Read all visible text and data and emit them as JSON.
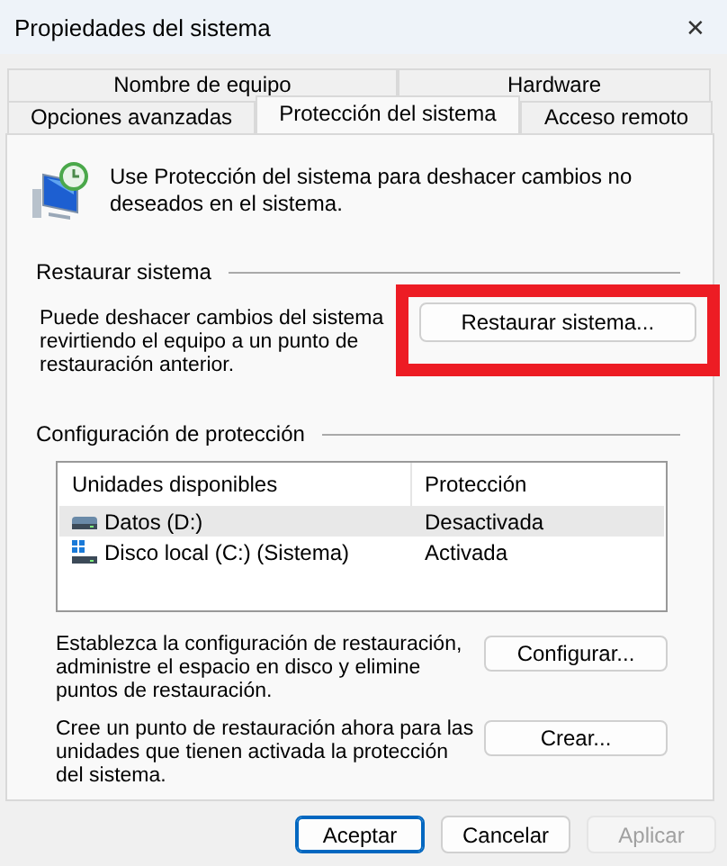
{
  "window": {
    "title": "Propiedades del sistema",
    "close": "✕"
  },
  "tabs": [
    [
      {
        "label": "Nombre de equipo",
        "selected": false
      },
      {
        "label": "Hardware",
        "selected": false
      }
    ],
    [
      {
        "label": "Opciones avanzadas",
        "selected": false
      },
      {
        "label": "Protección del sistema",
        "selected": true
      },
      {
        "label": "Acceso remoto",
        "selected": false
      }
    ]
  ],
  "intro": "Use Protección del sistema para deshacer cambios no deseados en el sistema.",
  "restore_group": {
    "title": "Restaurar sistema",
    "text": "Puede deshacer cambios del sistema revirtiendo el equipo a un punto de restauración anterior.",
    "button": {
      "label": "Restaurar sistema...",
      "highlighted": true
    }
  },
  "protection_group": {
    "title": "Configuración de protección",
    "table": {
      "columns": [
        "Unidades disponibles",
        "Protección"
      ],
      "rows": [
        {
          "kind": "data",
          "drive": "Datos (D:)",
          "protection": "Desactivada",
          "selected": true
        },
        {
          "kind": "system",
          "drive": "Disco local (C:) (Sistema)",
          "protection": "Activada",
          "selected": false
        }
      ]
    },
    "actions": [
      {
        "text": "Establezca la configuración de restauración, administre el espacio en disco y elimine puntos de restauración.",
        "button": "Configurar..."
      },
      {
        "text": "Cree un punto de restauración ahora para las unidades que tienen activada la protección del sistema.",
        "button": "Crear..."
      }
    ]
  },
  "buttons": [
    {
      "label": "Aceptar",
      "default": true,
      "disabled": false
    },
    {
      "label": "Cancelar",
      "default": false,
      "disabled": false
    },
    {
      "label": "Aplicar",
      "default": false,
      "disabled": true
    }
  ]
}
